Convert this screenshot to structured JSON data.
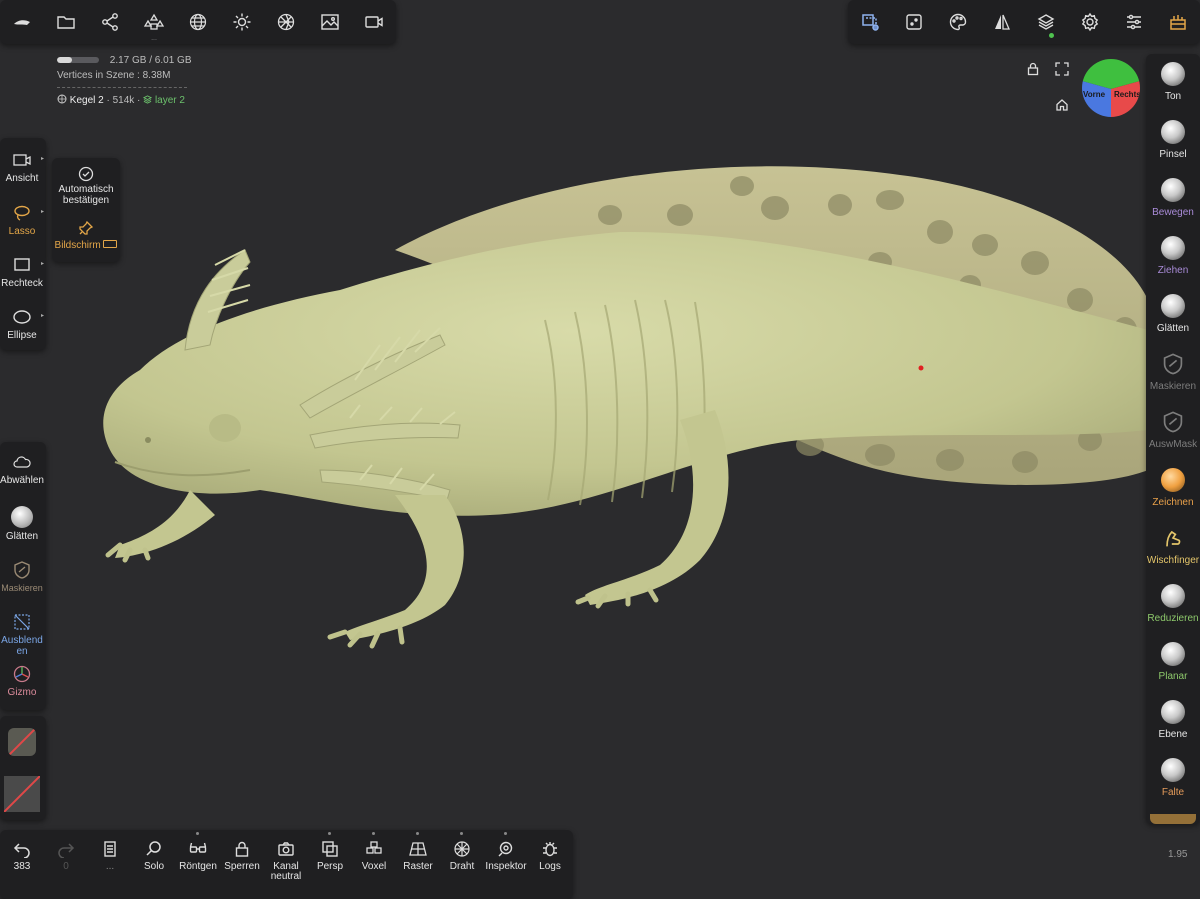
{
  "top_toolbar": {
    "items": [
      {
        "name": "app-logo-icon"
      },
      {
        "name": "folder-icon"
      },
      {
        "name": "scene-graph-icon"
      },
      {
        "name": "primitives-icon"
      },
      {
        "name": "sphere-grid-icon"
      },
      {
        "name": "light-icon"
      },
      {
        "name": "material-ball-icon"
      },
      {
        "name": "image-icon"
      },
      {
        "name": "video-icon"
      }
    ],
    "more_indicator": "..."
  },
  "top_right_toolbar": {
    "items": [
      {
        "name": "selection-tool-icon"
      },
      {
        "name": "dice-icon"
      },
      {
        "name": "palette-icon"
      },
      {
        "name": "symmetry-icon"
      },
      {
        "name": "layers-icon"
      },
      {
        "name": "settings-gear-icon"
      },
      {
        "name": "sliders-icon"
      },
      {
        "name": "toolbox-icon"
      }
    ]
  },
  "info": {
    "memory_text": "2.17 GB / 6.01 GB",
    "memory_fraction": 0.36,
    "vertices_label": "Vertices in Szene :",
    "vertices_value": "8.38M",
    "object_name": "Kegel 2",
    "object_verts": "· 514k ·",
    "layer_name": "layer 2"
  },
  "view_cube": {
    "right_face": "Rechts",
    "front_face": "Vorne"
  },
  "left_tools": {
    "ansicht": "Ansicht",
    "lasso": "Lasso",
    "rechteck": "Rechteck",
    "ellipse": "Ellipse",
    "abwaehlen": "Abwählen",
    "glaetten": "Glätten",
    "maskieren": "Maskieren",
    "ausblenden_1": "Ausblend",
    "ausblenden_2": "en",
    "gizmo": "Gizmo"
  },
  "popup": {
    "auto_confirm_1": "Automatisch",
    "auto_confirm_2": "bestätigen",
    "screen": "Bildschirm"
  },
  "right_brushes": [
    {
      "label": "Ton",
      "color": "#e6e6e6"
    },
    {
      "label": "Pinsel",
      "color": "#e6e6e6"
    },
    {
      "label": "Bewegen",
      "color": "#a98bd8"
    },
    {
      "label": "Ziehen",
      "color": "#a98bd8"
    },
    {
      "label": "Glätten",
      "color": "#e6e6e6"
    },
    {
      "label": "Maskieren",
      "color": "#7d7d7d"
    },
    {
      "label": "AuswMask",
      "color": "#7d7d7d"
    },
    {
      "label": "Zeichnen",
      "color": "#e8a04a"
    },
    {
      "label": "Wischfinger",
      "color": "#e3c56a"
    },
    {
      "label": "Reduzieren",
      "color": "#8dc86b"
    },
    {
      "label": "Planar",
      "color": "#8dc86b"
    },
    {
      "label": "Ebene",
      "color": "#e6e6e6"
    },
    {
      "label": "Falte",
      "color": "#e39a5a"
    }
  ],
  "bottom_toolbar": {
    "undo_count": "383",
    "redo_count": "0",
    "more": "...",
    "solo": "Solo",
    "roentgen": "Röntgen",
    "sperren": "Sperren",
    "kanal_1": "Kanal",
    "kanal_2": "neutral",
    "persp": "Persp",
    "voxel": "Voxel",
    "raster": "Raster",
    "draht": "Draht",
    "inspektor": "Inspektor",
    "logs": "Logs"
  },
  "version": "1.95",
  "colors": {
    "accent_orange": "#e3a648",
    "layer_green": "#6cc06c",
    "model_color": "#c9cc9a"
  }
}
